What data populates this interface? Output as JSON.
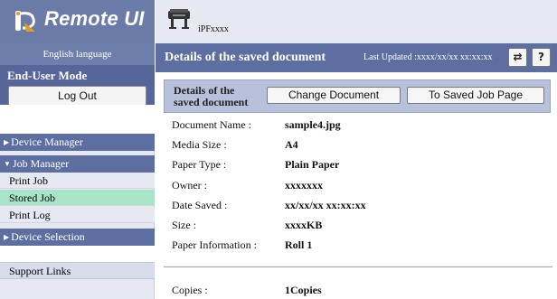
{
  "brand": {
    "logo_text": "Remote UI"
  },
  "language": "English language",
  "mode": {
    "title": "End-User Mode",
    "logout_label": "Log Out"
  },
  "nav": {
    "device_manager": "Device Manager",
    "job_manager": "Job Manager",
    "job_items": [
      "Print Job",
      "Stored Job",
      "Print Log"
    ],
    "active_item": "Stored Job",
    "device_selection": "Device Selection",
    "support_links": "Support Links"
  },
  "printer": {
    "name": "iPFxxxx"
  },
  "header": {
    "title": "Details of the saved document",
    "last_updated": "Last Updated :xxxx/xx/xx xx:xx:xx"
  },
  "section": {
    "label": "Details of the saved document",
    "change_button": "Change Document",
    "to_saved_job_button": "To Saved Job Page"
  },
  "details": [
    {
      "key": "Document Name :",
      "value": "sample4.jpg"
    },
    {
      "key": "Media Size :",
      "value": "A4"
    },
    {
      "key": "Paper Type :",
      "value": "Plain Paper"
    },
    {
      "key": "Owner :",
      "value": "xxxxxxx"
    },
    {
      "key": "Date Saved :",
      "value": "xx/xx/xx xx:xx:xx"
    },
    {
      "key": "Size :",
      "value": "xxxxKB"
    },
    {
      "key": "Paper Information :",
      "value": "Roll 1"
    }
  ],
  "copies": {
    "key": "Copies :",
    "value": "1Copies"
  },
  "colors": {
    "nav_header": "#5d6ea0",
    "active_item": "#a7e4c8",
    "section_bar": "#b8c1dc",
    "brand_bar": "#6b7ba8"
  },
  "icons": {
    "logo": "paper-roll-logo-icon",
    "printer": "large-format-printer-icon",
    "refresh": "refresh-icon",
    "help": "help-icon"
  }
}
